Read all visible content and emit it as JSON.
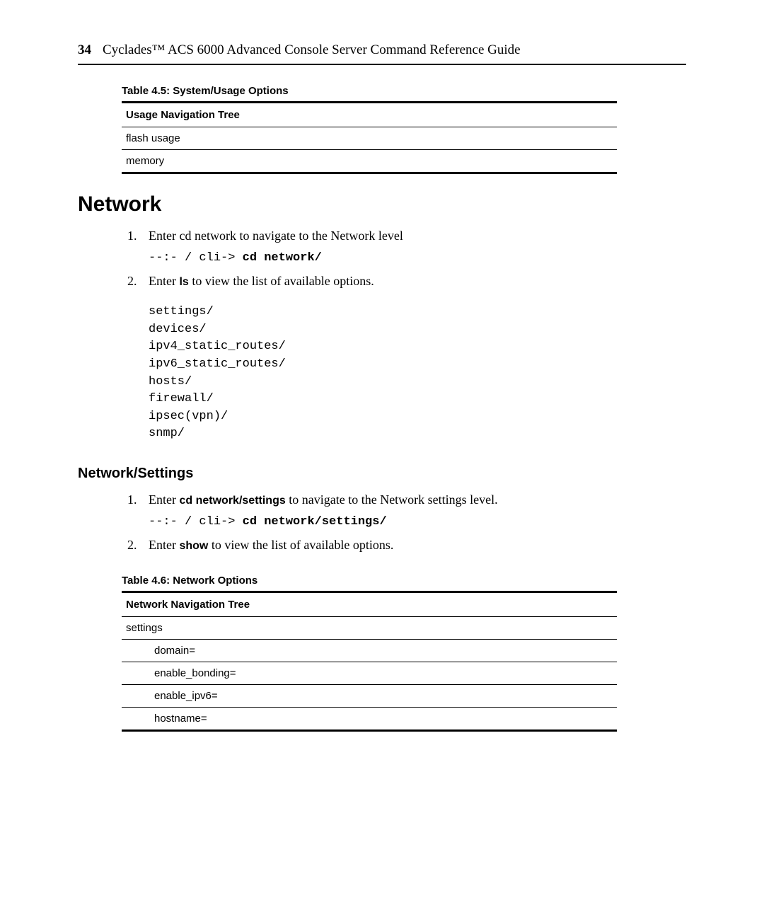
{
  "header": {
    "page_number": "34",
    "title": "Cyclades™ ACS 6000 Advanced Console Server Command Reference Guide"
  },
  "table45": {
    "caption": "Table 4.5: System/Usage Options",
    "header": "Usage Navigation Tree",
    "rows": [
      "flash usage",
      "memory"
    ]
  },
  "network_heading": "Network",
  "network_steps": {
    "s1_text": "Enter cd network to navigate to the Network level",
    "s1_code_prefix": "--:- / cli-> ",
    "s1_code_bold": "cd network/",
    "s2_prefix": "Enter ",
    "s2_cmd": "ls",
    "s2_suffix": " to view the list of available options."
  },
  "network_ls_output": "settings/\ndevices/\nipv4_static_routes/\nipv6_static_routes/\nhosts/\nfirewall/\nipsec(vpn)/\nsnmp/",
  "network_settings_heading": "Network/Settings",
  "ns_steps": {
    "s1_prefix": "Enter ",
    "s1_cmd": "cd network/settings",
    "s1_suffix": " to navigate to the Network settings level.",
    "s1_code_prefix": "--:- / cli-> ",
    "s1_code_bold": "cd network/settings/",
    "s2_prefix": "Enter ",
    "s2_cmd": "show",
    "s2_suffix": " to view the list of available options."
  },
  "table46": {
    "caption": "Table 4.6: Network Options",
    "header": "Network Navigation Tree",
    "root_row": "settings",
    "child_rows": [
      "domain=",
      "enable_bonding=",
      "enable_ipv6=",
      "hostname="
    ]
  }
}
